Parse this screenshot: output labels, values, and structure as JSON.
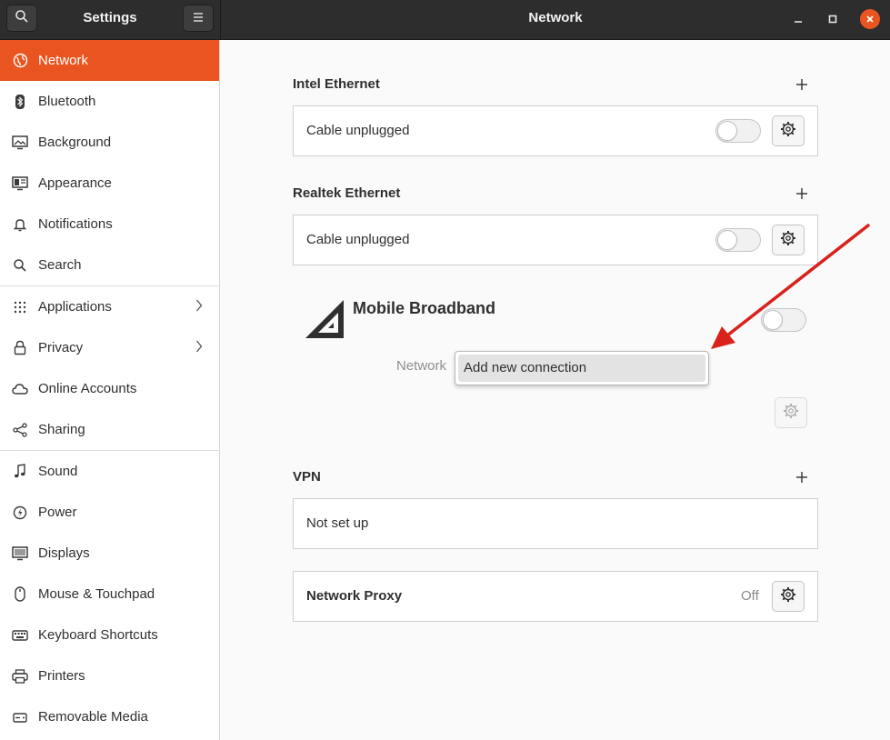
{
  "header": {
    "left_title": "Settings",
    "center_title": "Network"
  },
  "sidebar": {
    "items": [
      {
        "label": "Network",
        "icon": "network-icon"
      },
      {
        "label": "Bluetooth",
        "icon": "bluetooth-icon"
      },
      {
        "label": "Background",
        "icon": "background-icon"
      },
      {
        "label": "Appearance",
        "icon": "appearance-icon"
      },
      {
        "label": "Notifications",
        "icon": "bell-icon"
      },
      {
        "label": "Search",
        "icon": "search-icon"
      },
      {
        "label": "Applications",
        "icon": "apps-grid-icon"
      },
      {
        "label": "Privacy",
        "icon": "lock-icon"
      },
      {
        "label": "Online Accounts",
        "icon": "cloud-icon"
      },
      {
        "label": "Sharing",
        "icon": "share-icon"
      },
      {
        "label": "Sound",
        "icon": "music-note-icon"
      },
      {
        "label": "Power",
        "icon": "power-icon"
      },
      {
        "label": "Displays",
        "icon": "display-icon"
      },
      {
        "label": "Mouse & Touchpad",
        "icon": "mouse-icon"
      },
      {
        "label": "Keyboard Shortcuts",
        "icon": "keyboard-icon"
      },
      {
        "label": "Printers",
        "icon": "printer-icon"
      },
      {
        "label": "Removable Media",
        "icon": "removable-media-icon"
      }
    ],
    "active": "Network"
  },
  "main": {
    "intel": {
      "title": "Intel Ethernet",
      "status": "Cable unplugged"
    },
    "realtek": {
      "title": "Realtek Ethernet",
      "status": "Cable unplugged"
    },
    "mobile": {
      "title": "Mobile Broadband",
      "network_label": "Network",
      "dropdown_option": "Add new connection"
    },
    "vpn": {
      "title": "VPN",
      "status": "Not set up"
    },
    "proxy": {
      "title": "Network Proxy",
      "state": "Off"
    }
  },
  "colors": {
    "accent": "#e95420",
    "annotation_arrow": "#d9221c"
  }
}
